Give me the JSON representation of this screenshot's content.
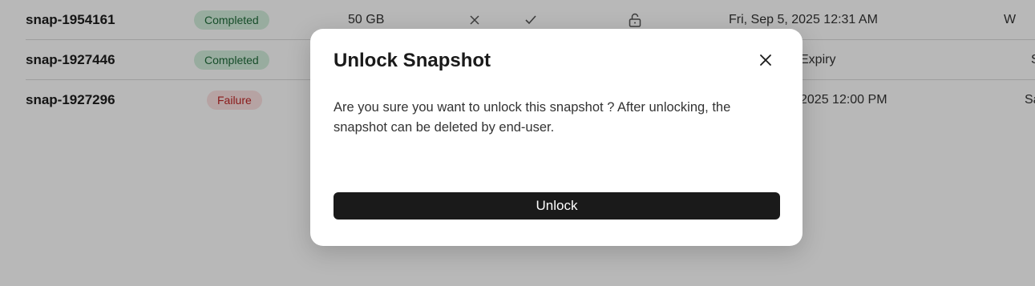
{
  "table": {
    "rows": [
      {
        "name": "snap-1954161",
        "status": "Completed",
        "size": "50 GB",
        "date": "Fri, Sep 5, 2025 12:31 AM",
        "extra": "W"
      },
      {
        "name": "snap-1927446",
        "status": "Completed",
        "date": "Expiry",
        "extra": "S"
      },
      {
        "name": "snap-1927296",
        "status": "Failure",
        "date": "2025 12:00 PM",
        "extra": "Sa"
      }
    ]
  },
  "icons": {
    "x": "close-x-icon",
    "check": "checkmark-icon",
    "lock": "unlocked-padlock-icon",
    "close": "close-icon"
  },
  "colors": {
    "completed_bg": "#d3efdd",
    "completed_text": "#1f6b3a",
    "failure_bg": "#fde2e2",
    "failure_text": "#c02626",
    "primary_button": "#1a1a1a"
  },
  "modal": {
    "title": "Unlock Snapshot",
    "body": "Are you sure you want to unlock this snapshot ? After unlocking, the snapshot can be deleted by end-user.",
    "confirm_label": "Unlock"
  }
}
